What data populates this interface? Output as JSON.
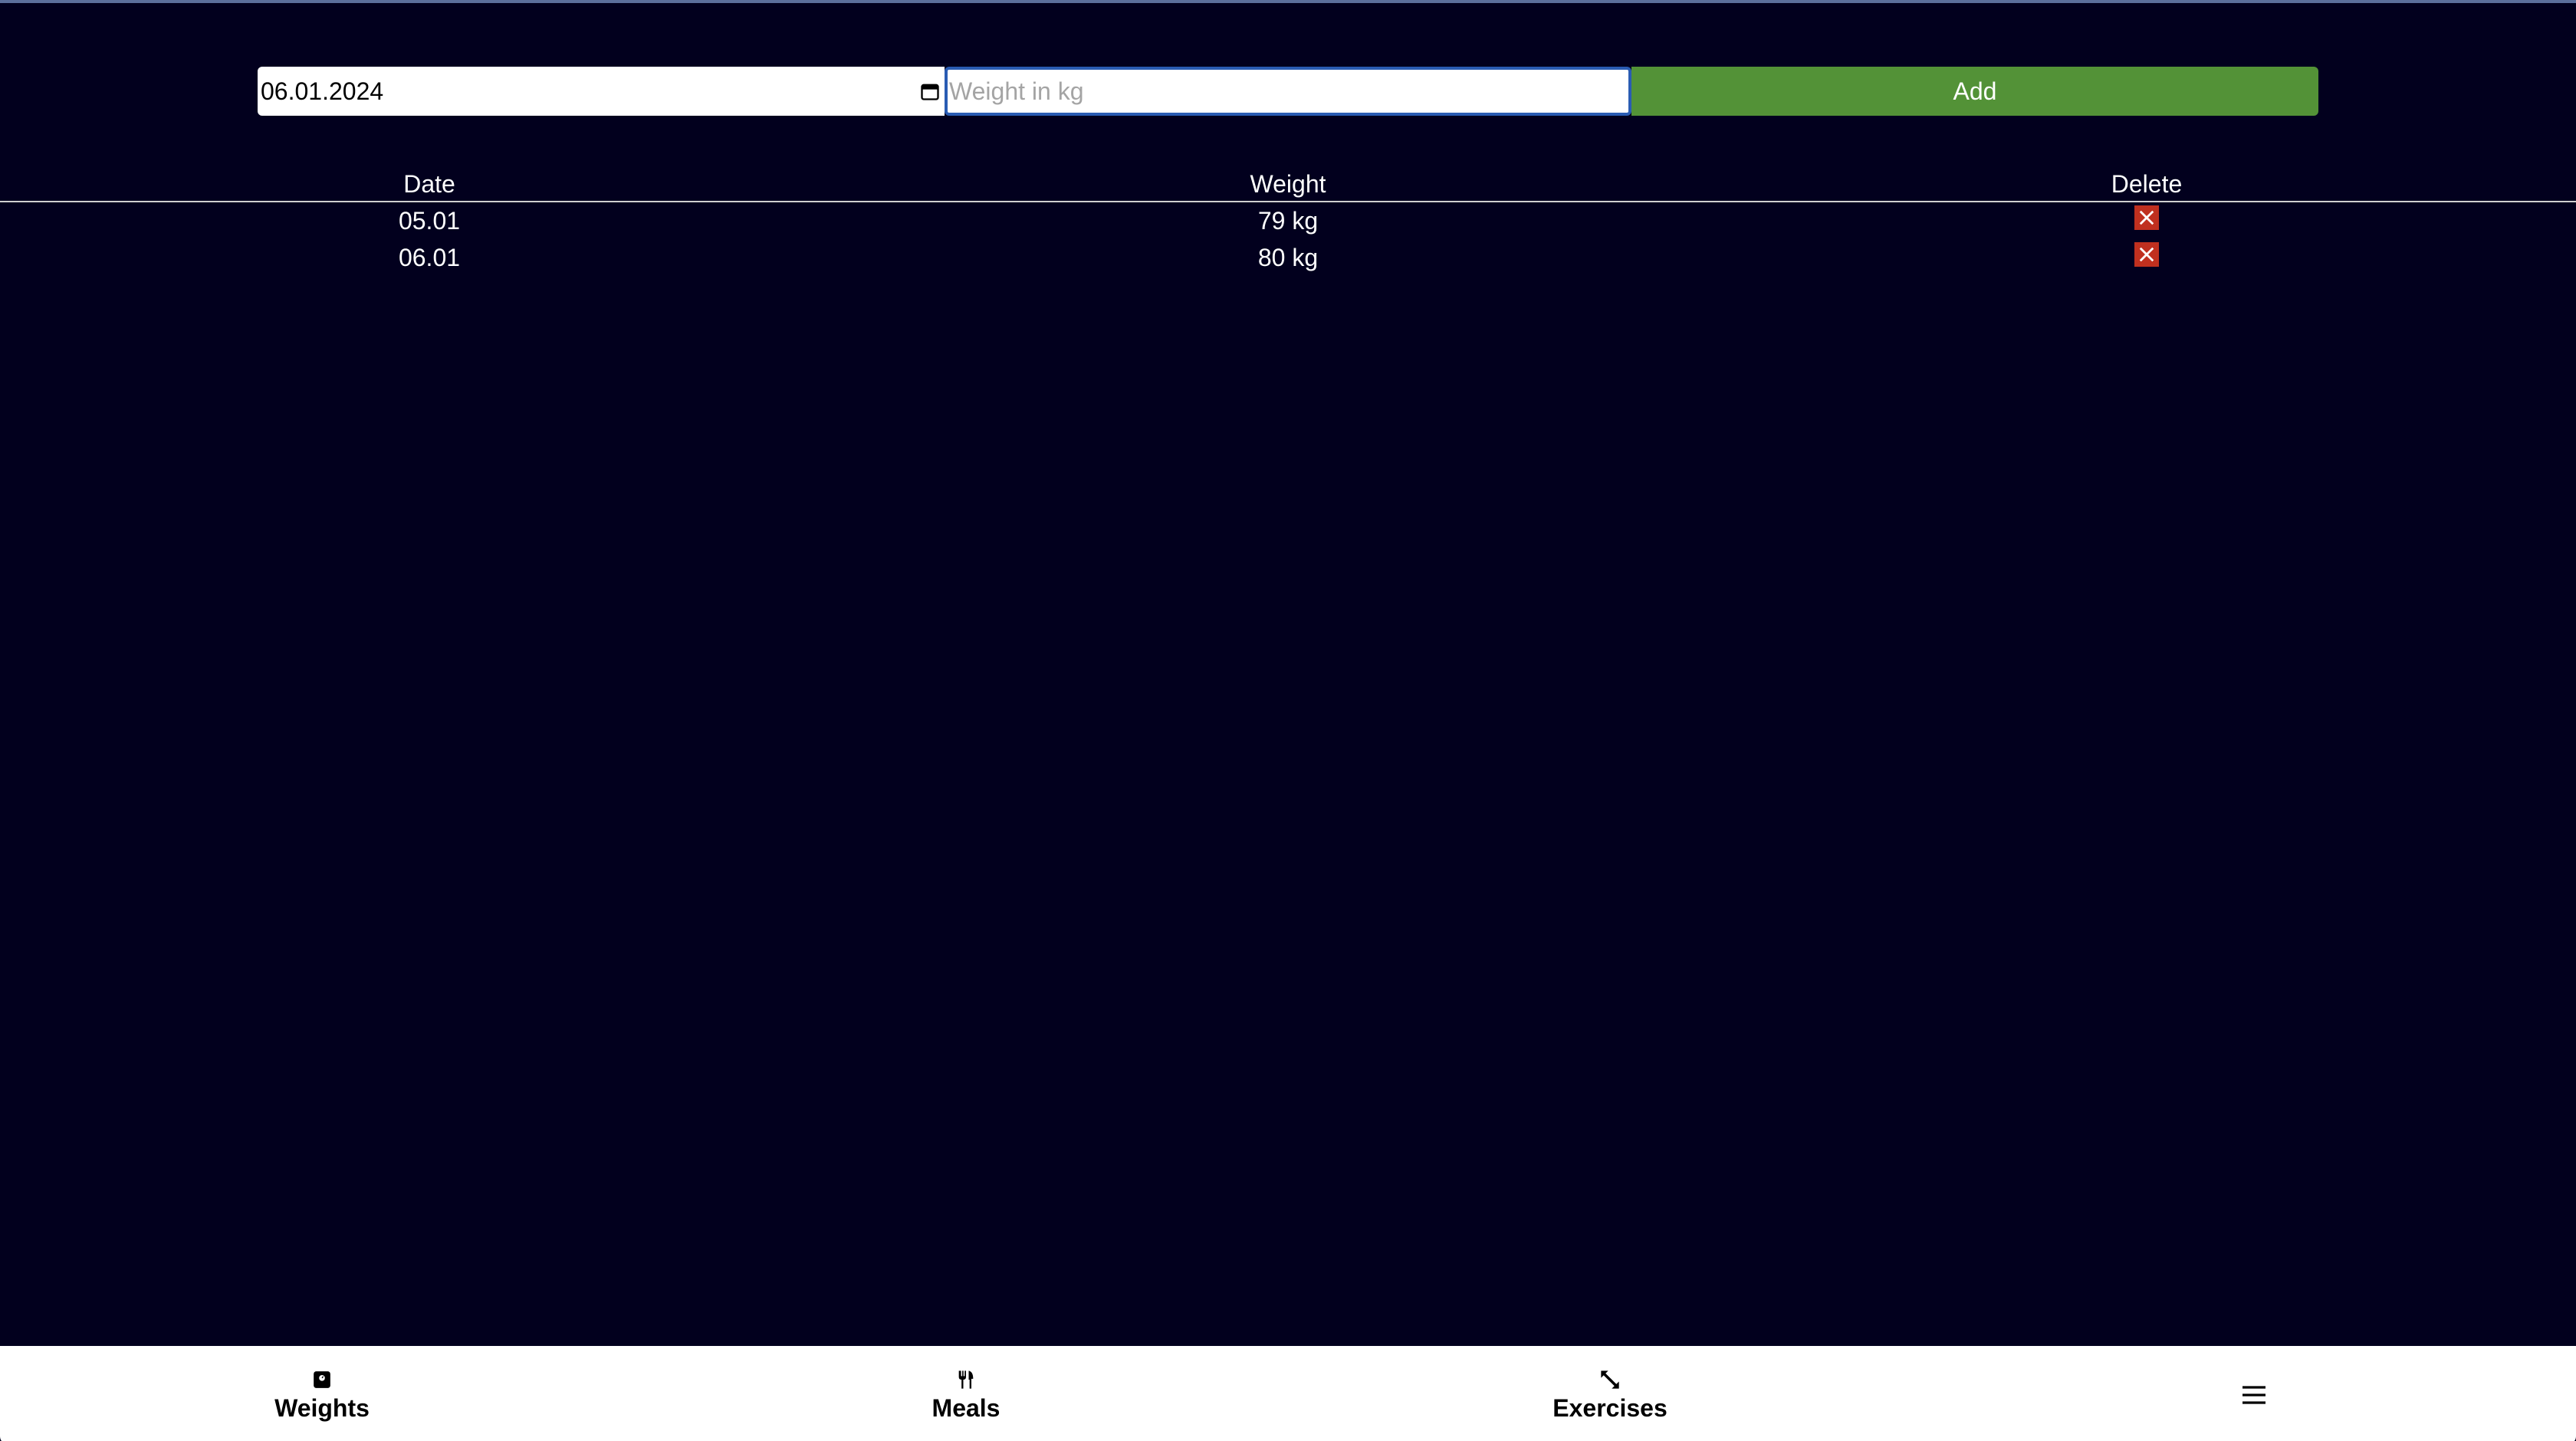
{
  "form": {
    "date_value": "06.01.2024",
    "weight_placeholder": "Weight in kg",
    "weight_value": "",
    "add_label": "Add"
  },
  "table": {
    "headers": {
      "date": "Date",
      "weight": "Weight",
      "delete": "Delete"
    },
    "rows": [
      {
        "date": "05.01",
        "weight": "79 kg"
      },
      {
        "date": "06.01",
        "weight": "80 kg"
      }
    ]
  },
  "nav": {
    "items": [
      {
        "label": "Weights",
        "icon": "scale-icon"
      },
      {
        "label": "Meals",
        "icon": "utensils-icon"
      },
      {
        "label": "Exercises",
        "icon": "expand-arrows-icon"
      },
      {
        "label": "",
        "icon": "hamburger-menu-icon"
      }
    ]
  },
  "colors": {
    "background": "#02001e",
    "add_button": "#539237",
    "delete_button": "#c0301f",
    "focus_border": "#2a5cb3",
    "nav_background": "#ffffff"
  }
}
